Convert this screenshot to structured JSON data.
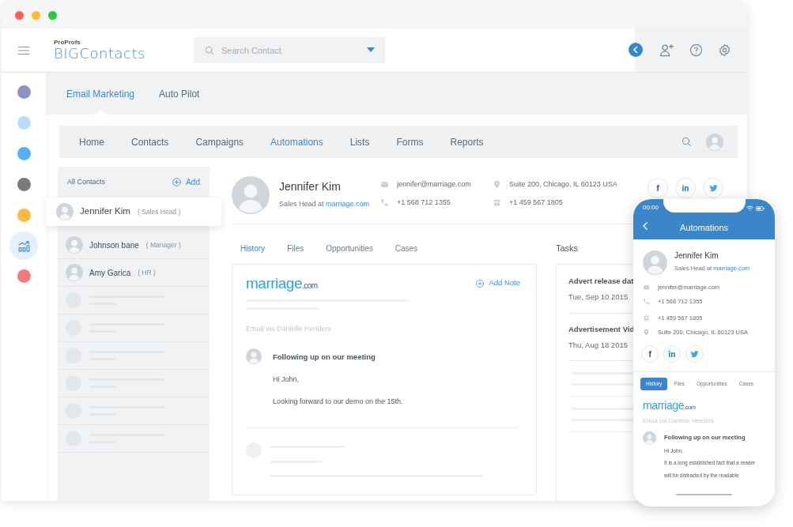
{
  "window": {
    "controls": [
      {
        "color": "#fe5f57"
      },
      {
        "color": "#febc2e"
      },
      {
        "color": "#28c840"
      }
    ]
  },
  "header": {
    "logo_small": "ProProfs",
    "logo": "BIGContacts",
    "search": {
      "placeholder": "Search Contact"
    }
  },
  "rail": [
    {
      "kind": "dot",
      "color": "#8c93c2",
      "selected": false
    },
    {
      "kind": "dot",
      "color": "#b9dcfb",
      "selected": false
    },
    {
      "kind": "dot",
      "color": "#5aaef6",
      "selected": false
    },
    {
      "kind": "dot",
      "color": "#7a7a7a",
      "selected": false
    },
    {
      "kind": "dot",
      "color": "#fdba45",
      "selected": false
    },
    {
      "kind": "chart",
      "selected": true
    },
    {
      "kind": "dot",
      "color": "#f0797d",
      "selected": false
    }
  ],
  "module_tabs": [
    {
      "label": "Email Marketing",
      "selected": true
    },
    {
      "label": "Auto Pilot",
      "selected": false
    }
  ],
  "nav": [
    {
      "label": "Home",
      "selected": false
    },
    {
      "label": "Contacts",
      "selected": false
    },
    {
      "label": "Campaigns",
      "selected": false
    },
    {
      "label": "Automations",
      "selected": true
    },
    {
      "label": "Lists",
      "selected": false
    },
    {
      "label": "Forms",
      "selected": false
    },
    {
      "label": "Reports",
      "selected": false
    }
  ],
  "contacts": {
    "title": "All Contacts",
    "add": "Add",
    "items": [
      {
        "name": "Jennifer Kim",
        "role": "( Sales Head )",
        "selected": true
      },
      {
        "name": "Johnson bane",
        "role": "( Manager )",
        "selected": false
      },
      {
        "name": "Amy Garica",
        "role": "( HR )",
        "selected": false
      }
    ]
  },
  "profile": {
    "name": "Jennifer Kim",
    "title": "Sales Head at",
    "company": "marriage.com",
    "email": "jennifer@marriage.com",
    "phone": "+1 568 712 1355",
    "address": "Suite 200, Chicago, IL 60123 USA",
    "landline": "+1 459 567 1805",
    "social": [
      {
        "kind": "facebook",
        "glyph": "f"
      },
      {
        "kind": "linkedin",
        "glyph": "in"
      },
      {
        "kind": "twitter"
      }
    ]
  },
  "detail_tabs": [
    {
      "label": "History",
      "selected": true
    },
    {
      "label": "Files",
      "selected": false
    },
    {
      "label": "Opportunities",
      "selected": false
    },
    {
      "label": "Cases",
      "selected": false
    }
  ],
  "history": {
    "logo": "marriage",
    "logo_suffix": ".com",
    "add_note": "Add Note",
    "via": "Email via Danielle Henders",
    "subject": "Following up on our meeting",
    "lines": [
      "Hi John,",
      "Looking forward to our demo on the 15th."
    ]
  },
  "tasks": {
    "title": "Tasks",
    "items": [
      {
        "title": "Advert release dat",
        "date": "Tue, Sep 10 2015"
      },
      {
        "title": "Advertisement Vid",
        "date": "Thu, Aug 18 2015"
      }
    ]
  },
  "phone": {
    "time": "00:00",
    "title": "Automations",
    "profile": {
      "name": "Jennifer Kim",
      "title": "Sales Head at",
      "company": "marriage.com",
      "email": "jennifer@marriage.com",
      "phone": "+1 568 712 1355",
      "landline": "+1 459 567 1805",
      "address": "Suite 200, Chicago, IL 60123 USA",
      "social": [
        {
          "kind": "facebook",
          "glyph": "f"
        },
        {
          "kind": "linkedin",
          "glyph": "in"
        },
        {
          "kind": "twitter"
        }
      ]
    },
    "tabs": [
      {
        "label": "History",
        "selected": true
      },
      {
        "label": "Files",
        "selected": false
      },
      {
        "label": "Opportunities",
        "selected": false
      },
      {
        "label": "Cases",
        "selected": false
      }
    ],
    "history": {
      "logo": "marriage",
      "logo_suffix": ".com",
      "via": "Email via Danielle Henders",
      "subject": "Following up on our meeting",
      "lines": [
        "Hi John,",
        "It is a long established fact that a reader",
        "will be distracted by the readable"
      ]
    }
  }
}
